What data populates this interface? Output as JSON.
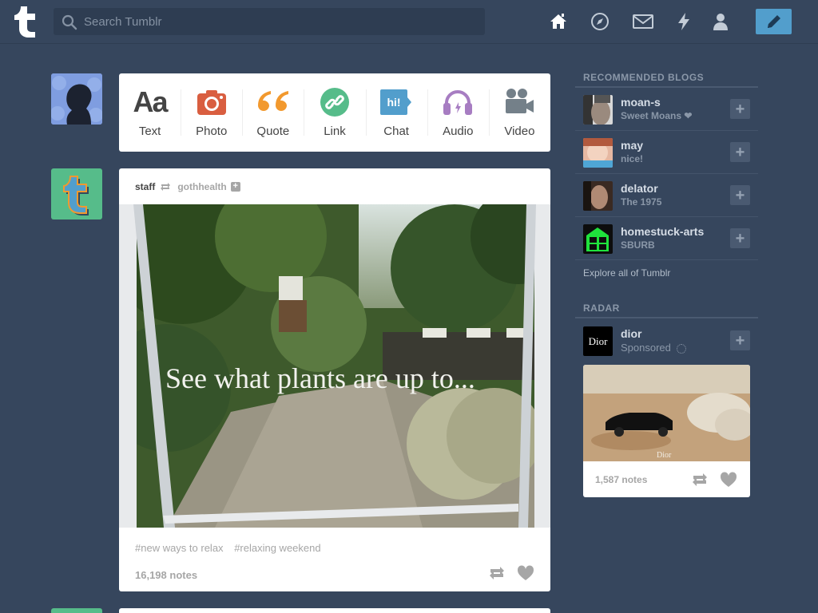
{
  "header": {
    "search_placeholder": "Search Tumblr",
    "nav_icons": [
      "home-icon",
      "explore-icon",
      "inbox-icon",
      "activity-icon",
      "account-icon"
    ],
    "compose_icon": "pencil-icon",
    "brand_color": "#529ecc"
  },
  "post_types": [
    {
      "label": "Text",
      "icon": "text-icon"
    },
    {
      "label": "Photo",
      "icon": "camera-icon"
    },
    {
      "label": "Quote",
      "icon": "quote-icon"
    },
    {
      "label": "Link",
      "icon": "link-icon"
    },
    {
      "label": "Chat",
      "icon": "chat-icon"
    },
    {
      "label": "Audio",
      "icon": "headphones-icon"
    },
    {
      "label": "Video",
      "icon": "video-camera-icon"
    }
  ],
  "post": {
    "author": "staff",
    "source": "gothhealth",
    "image_caption": "See what plants are up to...",
    "tags": [
      "#new ways to relax",
      "#relaxing weekend"
    ],
    "notes": "16,198 notes"
  },
  "sidebar": {
    "recommended_title": "RECOMMENDED BLOGS",
    "blogs": [
      {
        "name": "moan-s",
        "subtitle": "Sweet Moans ❤"
      },
      {
        "name": "may",
        "subtitle": "nice!"
      },
      {
        "name": "delator",
        "subtitle": "The 1975"
      },
      {
        "name": "homestuck-arts",
        "subtitle": "SBURB"
      }
    ],
    "follow_label": "+",
    "explore_link": "Explore all of Tumblr",
    "radar_title": "RADAR",
    "radar": {
      "name": "dior",
      "subtitle": "Sponsored",
      "avatar_text": "Dior",
      "image_watermark": "Dior",
      "notes": "1,587 notes"
    }
  }
}
